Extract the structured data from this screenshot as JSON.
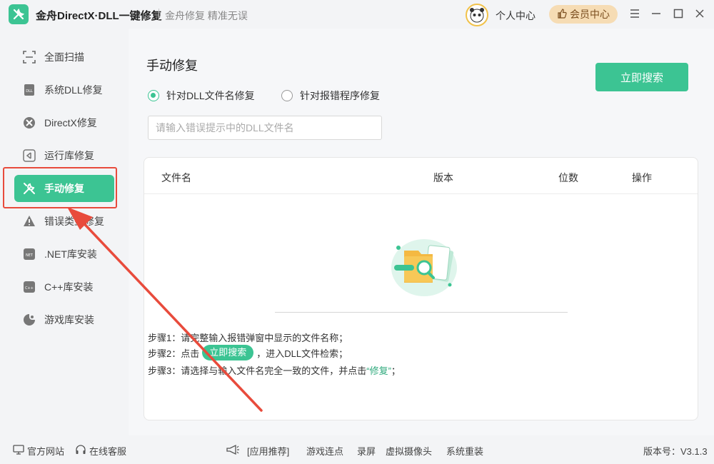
{
  "window": {
    "title": "金舟DirectX·DLL一键修复",
    "slogan": "金舟修复 精准无误",
    "profile_label": "个人中心",
    "vip_label": "会员中心"
  },
  "sidebar": {
    "items": [
      {
        "label": "全面扫描",
        "icon": "scan-icon"
      },
      {
        "label": "系统DLL修复",
        "icon": "dll-icon"
      },
      {
        "label": "DirectX修复",
        "icon": "directx-icon"
      },
      {
        "label": "运行库修复",
        "icon": "runtime-icon"
      },
      {
        "label": "手动修复",
        "icon": "wrench-icon",
        "active": true
      },
      {
        "label": "错误类型修复",
        "icon": "warning-icon"
      },
      {
        "label": ".NET库安装",
        "icon": "dotnet-icon"
      },
      {
        "label": "C++库安装",
        "icon": "cpp-icon"
      },
      {
        "label": "游戏库安装",
        "icon": "game-icon"
      }
    ]
  },
  "main": {
    "title": "手动修复",
    "search_button": "立即搜索",
    "radio_options": [
      {
        "label": "针对DLL文件名修复",
        "checked": true
      },
      {
        "label": "针对报错程序修复",
        "checked": false
      }
    ],
    "input_placeholder": "请输入错误提示中的DLL文件名",
    "table_headers": [
      "文件名",
      "版本",
      "位数",
      "操作"
    ],
    "steps": {
      "step1": "步骤1：请完整输入报错弹窗中显示的文件名称；",
      "step2_prefix": "步骤2：点击",
      "step2_pill": "立即搜索",
      "step2_suffix": "，进入DLL文件检索；",
      "step3_prefix": "步骤3：请选择与输入文件名完全一致的文件，并点击",
      "step3_quote": "“修复”",
      "step3_suffix": "；"
    }
  },
  "footer": {
    "website": "官方网站",
    "support": "在线客服",
    "app_recommend": "[应用推荐]",
    "links": [
      "游戏连点",
      "录屏",
      "虚拟摄像头",
      "系统重装"
    ],
    "version": "版本号：V3.1.3"
  },
  "colors": {
    "accent": "#3cc493",
    "annotation": "#e84b3c",
    "vip_bg": "#f6dcb4"
  }
}
